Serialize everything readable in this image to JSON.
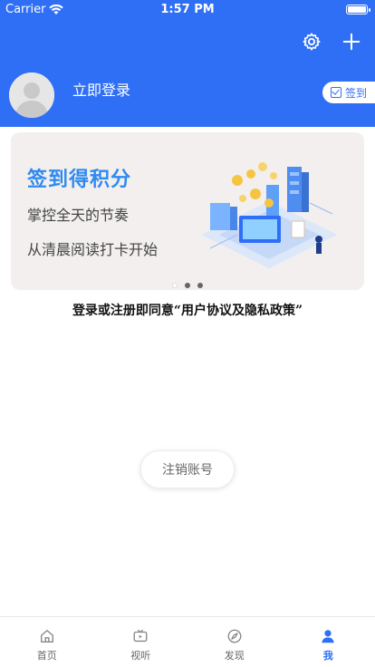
{
  "status_bar": {
    "carrier": "Carrier",
    "time": "1:57 PM",
    "battery_level": 1.0
  },
  "header": {
    "login_text": "立即登录",
    "checkin_label": "签到",
    "accent_color": "#2f6ff6"
  },
  "banner": {
    "title": "签到得积分",
    "line1": "掌控全天的节奏",
    "line2": "从清晨阅读打卡开始",
    "page_count": 3,
    "active_page": 1
  },
  "agreement_text": "登录或注册即同意“用户协议及隐私政策”",
  "logout_label": "注销账号",
  "tabbar": {
    "items": [
      {
        "label": "首页",
        "icon": "home-icon",
        "active": false
      },
      {
        "label": "视听",
        "icon": "tv-icon",
        "active": false
      },
      {
        "label": "发现",
        "icon": "compass-icon",
        "active": false
      },
      {
        "label": "我",
        "icon": "user-icon",
        "active": true
      }
    ]
  }
}
